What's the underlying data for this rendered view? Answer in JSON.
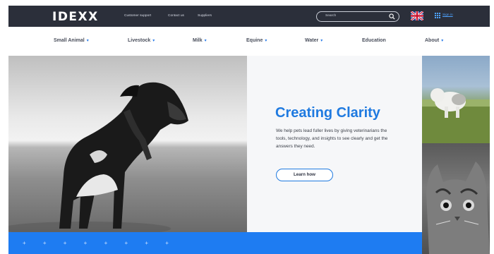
{
  "header": {
    "logo": "IDEXX",
    "links": [
      "Customer support",
      "Contact us",
      "Suppliers"
    ],
    "search_placeholder": "Search",
    "sign_in": "Sign in"
  },
  "nav": {
    "items": [
      {
        "label": "Small Animal",
        "has_menu": true
      },
      {
        "label": "Livestock",
        "has_menu": true
      },
      {
        "label": "Milk",
        "has_menu": true
      },
      {
        "label": "Equine",
        "has_menu": true
      },
      {
        "label": "Water",
        "has_menu": true
      },
      {
        "label": "Education",
        "has_menu": false
      },
      {
        "label": "About",
        "has_menu": true
      }
    ]
  },
  "hero": {
    "title": "Creating Clarity",
    "text": "We help pets lead fuller lives by giving veterinarians the tools, technology, and insights to see clearly and get the answers they need.",
    "button": "Learn how"
  },
  "band": {
    "decor": "+ + + + + + + +"
  },
  "colors": {
    "topbar": "#2b2f3a",
    "brand_blue": "#1f7ae0",
    "band_blue": "#1e7cf2"
  },
  "icons": {
    "search": "search-icon",
    "flag": "uk-flag-icon",
    "grid": "grid-icon",
    "chevron": "chevron-down-icon"
  }
}
